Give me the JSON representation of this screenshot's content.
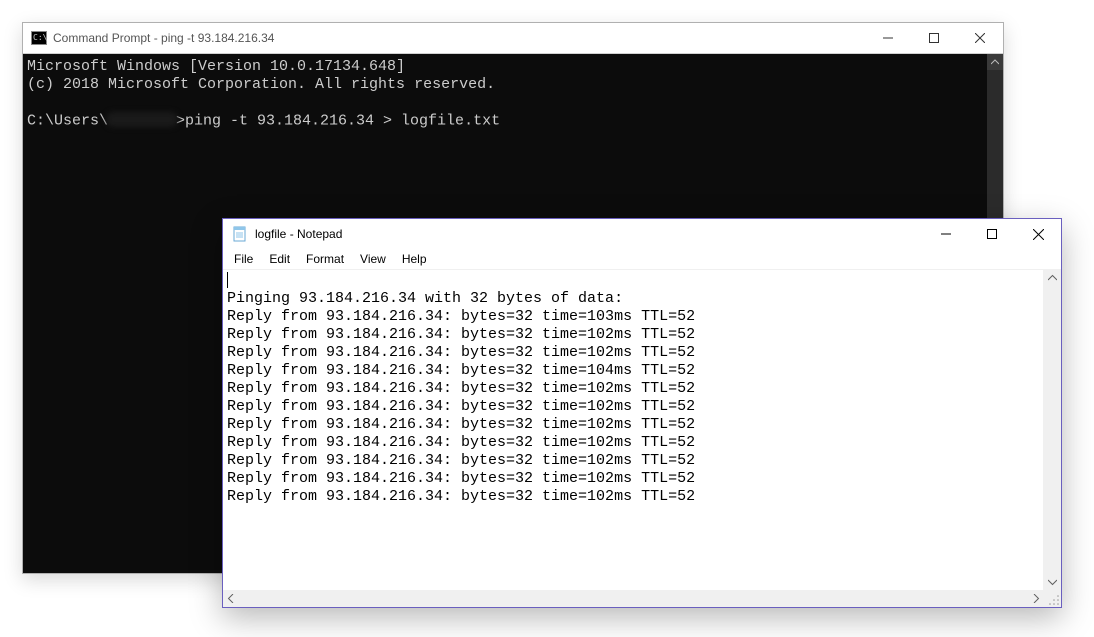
{
  "cmd": {
    "title": "Command Prompt - ping  -t 93.184.216.34",
    "lines": {
      "l0": "Microsoft Windows [Version 10.0.17134.648]",
      "l1": "(c) 2018 Microsoft Corporation. All rights reserved.",
      "l2": "",
      "prompt_prefix": "C:\\Users\\",
      "prompt_suffix": ">ping -t 93.184.216.34 > logfile.txt"
    }
  },
  "notepad": {
    "title": "logfile - Notepad",
    "menu": {
      "file": "File",
      "edit": "Edit",
      "format": "Format",
      "view": "View",
      "help": "Help"
    },
    "content": "\nPinging 93.184.216.34 with 32 bytes of data:\nReply from 93.184.216.34: bytes=32 time=103ms TTL=52\nReply from 93.184.216.34: bytes=32 time=102ms TTL=52\nReply from 93.184.216.34: bytes=32 time=102ms TTL=52\nReply from 93.184.216.34: bytes=32 time=104ms TTL=52\nReply from 93.184.216.34: bytes=32 time=102ms TTL=52\nReply from 93.184.216.34: bytes=32 time=102ms TTL=52\nReply from 93.184.216.34: bytes=32 time=102ms TTL=52\nReply from 93.184.216.34: bytes=32 time=102ms TTL=52\nReply from 93.184.216.34: bytes=32 time=102ms TTL=52\nReply from 93.184.216.34: bytes=32 time=102ms TTL=52\nReply from 93.184.216.34: bytes=32 time=102ms TTL=52"
  }
}
